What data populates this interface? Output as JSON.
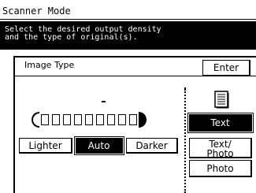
{
  "header": {
    "title": "Scanner Mode"
  },
  "banner": {
    "line1": "Select the desired output density",
    "line2": "and the type of original(s)."
  },
  "image_type": {
    "label": "Image Type",
    "enter_label": "Enter"
  },
  "density": {
    "cells": 9,
    "level": "Auto",
    "buttons": {
      "lighter": "Lighter",
      "auto": "Auto",
      "darker": "Darker"
    }
  },
  "original": {
    "icon": "document-icon",
    "selected": "Text",
    "buttons": {
      "text": "Text",
      "text_photo_line1": "Text/",
      "text_photo_line2": "Photo",
      "photo": "Photo"
    }
  },
  "colors": {
    "background": "#ffffff",
    "foreground": "#000000"
  }
}
